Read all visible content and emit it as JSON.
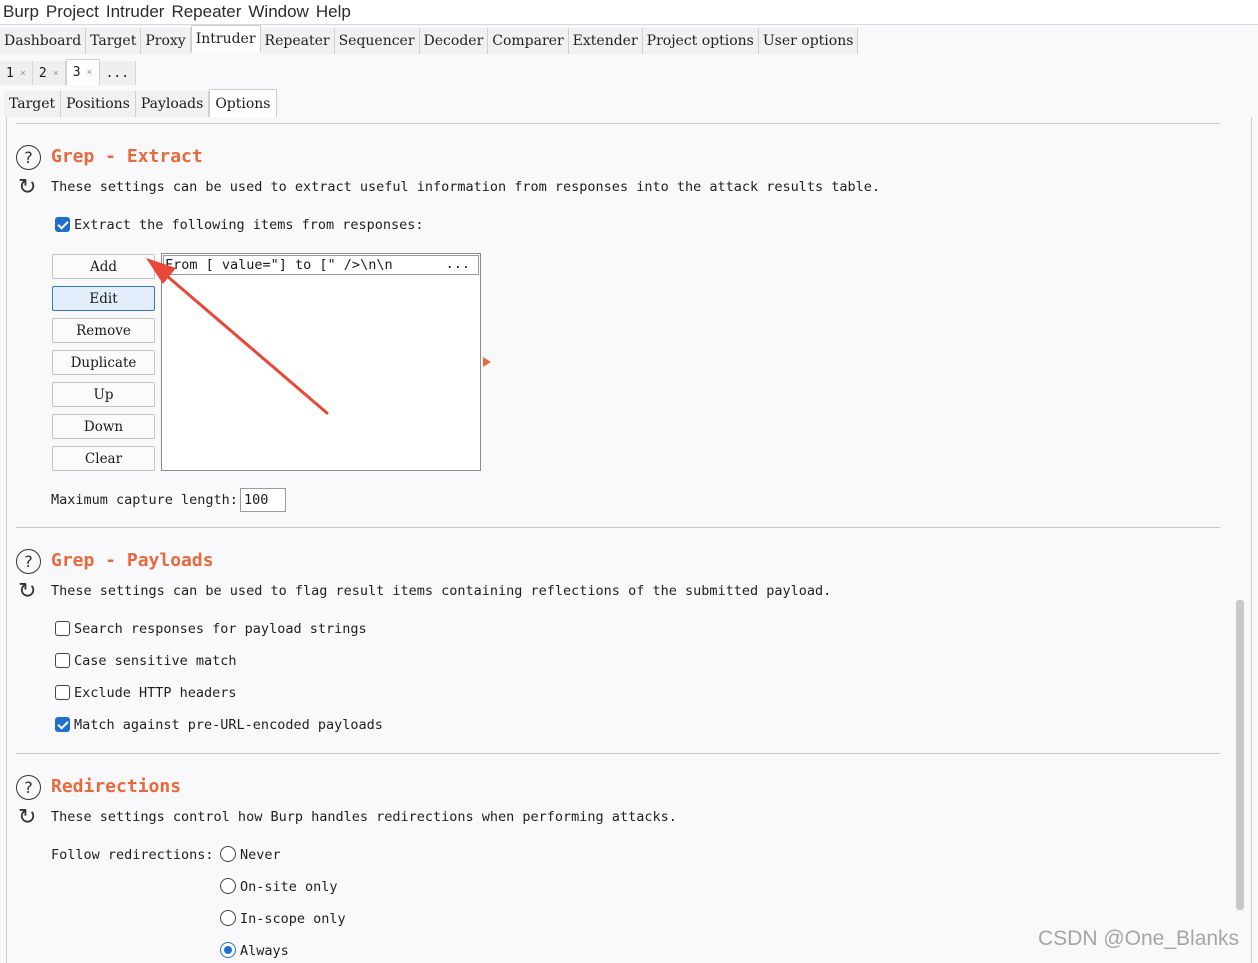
{
  "menubar": [
    "Burp",
    "Project",
    "Intruder",
    "Repeater",
    "Window",
    "Help"
  ],
  "main_tabs": [
    "Dashboard",
    "Target",
    "Proxy",
    "Intruder",
    "Repeater",
    "Sequencer",
    "Decoder",
    "Comparer",
    "Extender",
    "Project options",
    "User options"
  ],
  "attack_tabs": {
    "t1": "1",
    "t2": "2",
    "t3": "3",
    "more": "...",
    "close": "×"
  },
  "sub_tabs": [
    "Target",
    "Positions",
    "Payloads",
    "Options"
  ],
  "grep_extract": {
    "title": "Grep - Extract",
    "description": "These settings can be used to extract useful information from responses into the attack results table.",
    "checkbox_label": "Extract the following items from responses:",
    "checkbox_checked": true,
    "buttons": [
      "Add",
      "Edit",
      "Remove",
      "Duplicate",
      "Up",
      "Down",
      "Clear"
    ],
    "items": [
      {
        "text": "From [ value=\"] to [\" />\\n\\n",
        "more": "..."
      }
    ],
    "max_capture_label": "Maximum capture length:",
    "max_capture_value": "100"
  },
  "grep_payloads": {
    "title": "Grep - Payloads",
    "description": "These settings can be used to flag result items containing reflections of the submitted payload.",
    "options": [
      {
        "label": "Search responses for payload strings",
        "checked": false
      },
      {
        "label": "Case sensitive match",
        "checked": false
      },
      {
        "label": "Exclude HTTP headers",
        "checked": false
      },
      {
        "label": "Match against pre-URL-encoded payloads",
        "checked": true
      }
    ]
  },
  "redirections": {
    "title": "Redirections",
    "description": "These settings control how Burp handles redirections when performing attacks.",
    "follow_label": "Follow redirections:",
    "options": [
      {
        "label": "Never",
        "selected": false
      },
      {
        "label": "On-site only",
        "selected": false
      },
      {
        "label": "In-scope only",
        "selected": false
      },
      {
        "label": "Always",
        "selected": true
      }
    ]
  },
  "colors": {
    "accent": "#e8693b",
    "check": "#1e6fd0",
    "annotation_arrow": "#e8473a"
  },
  "watermark": "CSDN @One_Blanks"
}
